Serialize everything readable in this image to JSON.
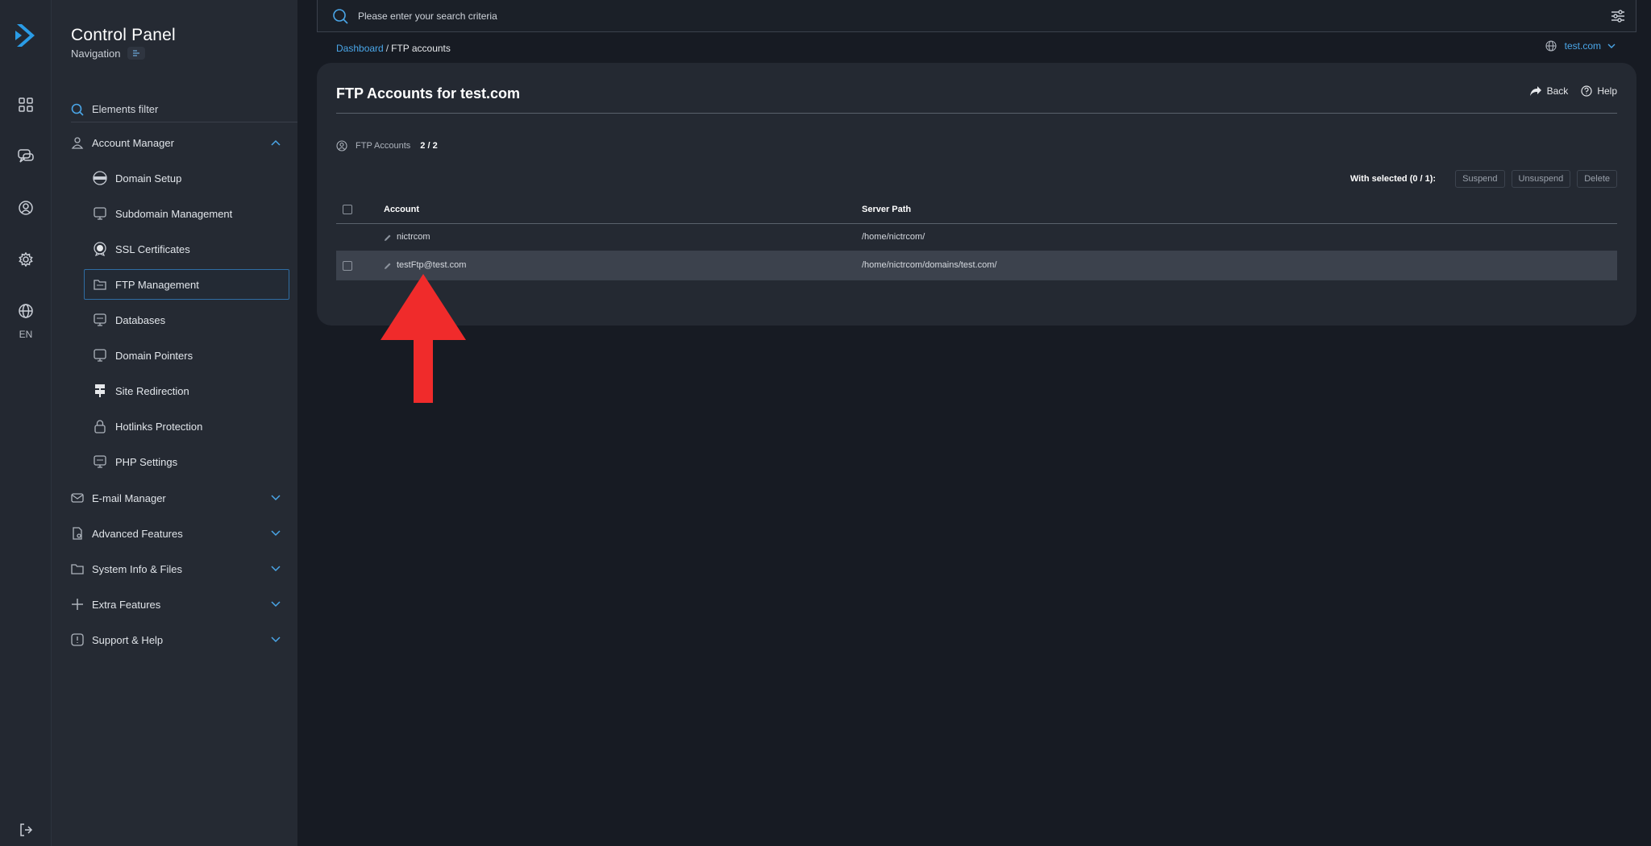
{
  "rail": {
    "language": "EN",
    "icons": [
      "logo-icon",
      "dashboard-icon",
      "chat-icon",
      "user-icon",
      "settings-icon",
      "globe-icon",
      "logout-icon"
    ]
  },
  "sidebar": {
    "title": "Control Panel",
    "subtitle": "Navigation",
    "filter_placeholder": "Elements filter",
    "groups": {
      "account_manager": "Account Manager",
      "email_manager": "E-mail Manager",
      "advanced_features": "Advanced Features",
      "system_info": "System Info & Files",
      "extra_features": "Extra Features",
      "support_help": "Support & Help"
    },
    "items": [
      {
        "label": "Domain Setup"
      },
      {
        "label": "Subdomain Management"
      },
      {
        "label": "SSL Certificates"
      },
      {
        "label": "FTP Management"
      },
      {
        "label": "Databases"
      },
      {
        "label": "Domain Pointers"
      },
      {
        "label": "Site Redirection"
      },
      {
        "label": "Hotlinks Protection"
      },
      {
        "label": "PHP Settings"
      }
    ]
  },
  "search": {
    "placeholder": "Please enter your search criteria"
  },
  "breadcrumb": {
    "root": "Dashboard",
    "separator": "/",
    "current": "FTP accounts"
  },
  "domain_selector": {
    "value": "test.com"
  },
  "main": {
    "title": "FTP Accounts for test.com",
    "back_label": "Back",
    "help_label": "Help",
    "count_label": "FTP Accounts",
    "count_value": "2 / 2",
    "bulk": {
      "label": "With selected (0 / 1):",
      "suspend": "Suspend",
      "unsuspend": "Unsuspend",
      "delete": "Delete"
    },
    "table": {
      "headers": {
        "account": "Account",
        "server_path": "Server Path"
      },
      "rows": [
        {
          "account": "nictrcom",
          "server_path": "/home/nictrcom/"
        },
        {
          "account": "testFtp@test.com",
          "server_path": "/home/nictrcom/domains/test.com/"
        }
      ]
    }
  },
  "colors": {
    "accent": "#4aa6e8",
    "background": "#171b23",
    "sidebar": "#252a33",
    "card": "#242932",
    "annotation_arrow": "#f02b2b"
  }
}
